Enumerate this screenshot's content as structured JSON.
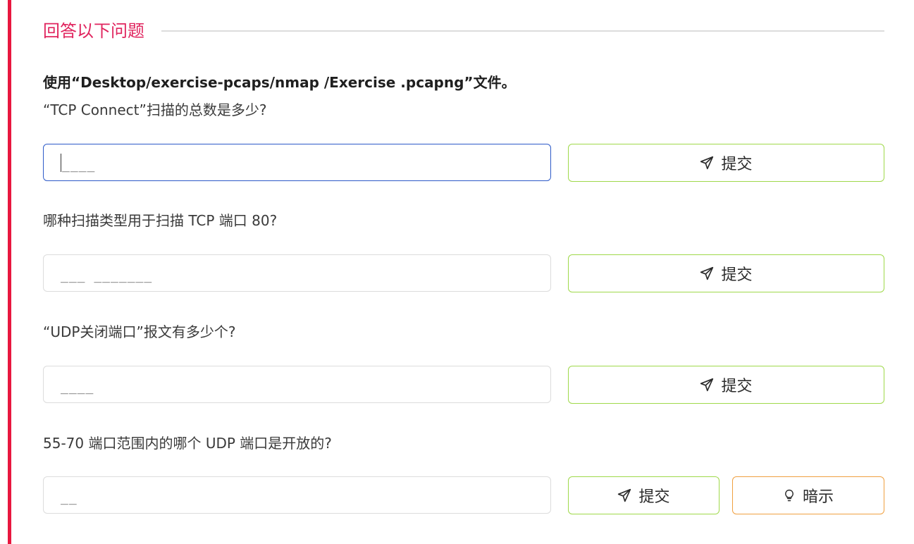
{
  "section": {
    "title": "回答以下问题"
  },
  "intro": "使用“Desktop/exercise-pcaps/nmap /Exercise .pcapng”文件。",
  "questions": [
    {
      "text": "“TCP Connect”扫描的总数是多少?",
      "placeholder": "____",
      "submit_label": "提交"
    },
    {
      "text": "哪种扫描类型用于扫描 TCP 端口 80?",
      "placeholder": "___ _______",
      "submit_label": "提交"
    },
    {
      "text": "“UDP关闭端口”报文有多少个?",
      "placeholder": "____",
      "submit_label": "提交"
    },
    {
      "text": "55-70 端口范围内的哪个 UDP 端口是开放的?",
      "placeholder": "__",
      "submit_label": "提交",
      "hint_label": "暗示"
    }
  ],
  "icons": {
    "submit": "send-icon",
    "hint": "lightbulb-icon"
  },
  "colors": {
    "accent": "#e8173f",
    "title": "#e0245e",
    "submit_border": "#9fd94a",
    "hint_border": "#f0a040",
    "focus_border": "#2d5ac8"
  }
}
